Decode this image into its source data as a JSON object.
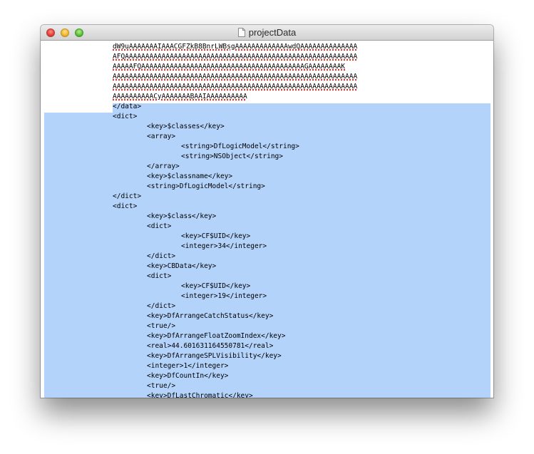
{
  "window": {
    "title": "projectData"
  },
  "editor": {
    "lines": [
      {
        "text": "dW9uAAAAAAAIAAACGFZkB8BnrLWBsgAAAAAAAAAAAAAwdQAAAAAAAAAAAAAA",
        "misspelled": true
      },
      {
        "text": "AFQAAAAAAAAAAAAAAAAAAAAAAAAAAAAAAAAAAAAAAAAAAAAAAAAAAAAAAAAA",
        "misspelled": true
      },
      {
        "text": "AAAAAFQAAAAAAAAAAAAAAAAAAAAAAAAAAAAAAAAAAAAAAAAGAAAAAAAAK",
        "misspelled": true
      },
      {
        "text": "AAAAAAAAAAAAAAAAAAAAAAAAAAAAAAAAAAAAAAAAAAAAAAAAAAAAAAAAAAAA",
        "misspelled": true
      },
      {
        "text": "AAAAAAAAAAAAAAAAAAAAAAAAAAAAAAAAAAAAAAAAAAAAAAAAAAAAAAAAAAAA",
        "misspelled": true
      },
      {
        "text": "AAAAAAAAAACyAAAAAAABAAIAAAAAAAAAA",
        "misspelled": true
      },
      {
        "text": "</data>",
        "misspelled": false
      },
      {
        "text": "<dict>",
        "misspelled": false
      },
      {
        "text": "\t<key>$classes</key>",
        "misspelled": false
      },
      {
        "text": "\t<array>",
        "misspelled": false
      },
      {
        "text": "\t\t<string>DfLogicModel</string>",
        "misspelled": false
      },
      {
        "text": "\t\t<string>NSObject</string>",
        "misspelled": false
      },
      {
        "text": "\t</array>",
        "misspelled": false
      },
      {
        "text": "\t<key>$classname</key>",
        "misspelled": false
      },
      {
        "text": "\t<string>DfLogicModel</string>",
        "misspelled": false
      },
      {
        "text": "</dict>",
        "misspelled": false
      },
      {
        "text": "<dict>",
        "misspelled": false
      },
      {
        "text": "\t<key>$class</key>",
        "misspelled": false
      },
      {
        "text": "\t<dict>",
        "misspelled": false
      },
      {
        "text": "\t\t<key>CF$UID</key>",
        "misspelled": false
      },
      {
        "text": "\t\t<integer>34</integer>",
        "misspelled": false
      },
      {
        "text": "\t</dict>",
        "misspelled": false
      },
      {
        "text": "\t<key>CBData</key>",
        "misspelled": false
      },
      {
        "text": "\t<dict>",
        "misspelled": false
      },
      {
        "text": "\t\t<key>CF$UID</key>",
        "misspelled": false
      },
      {
        "text": "\t\t<integer>19</integer>",
        "misspelled": false
      },
      {
        "text": "\t</dict>",
        "misspelled": false
      },
      {
        "text": "\t<key>DfArrangeCatchStatus</key>",
        "misspelled": false
      },
      {
        "text": "\t<true/>",
        "misspelled": false
      },
      {
        "text": "\t<key>DfArrangeFloatZoomIndex</key>",
        "misspelled": false
      },
      {
        "text": "\t<real>44.601631164550781</real>",
        "misspelled": false
      },
      {
        "text": "\t<key>DfArrangeSPLVisibility</key>",
        "misspelled": false
      },
      {
        "text": "\t<integer>1</integer>",
        "misspelled": false
      },
      {
        "text": "\t<key>DfCountIn</key>",
        "misspelled": false
      },
      {
        "text": "\t<true/>",
        "misspelled": false
      },
      {
        "text": "\t<key>DfLastChromatic</key>",
        "misspelled": false
      }
    ]
  }
}
